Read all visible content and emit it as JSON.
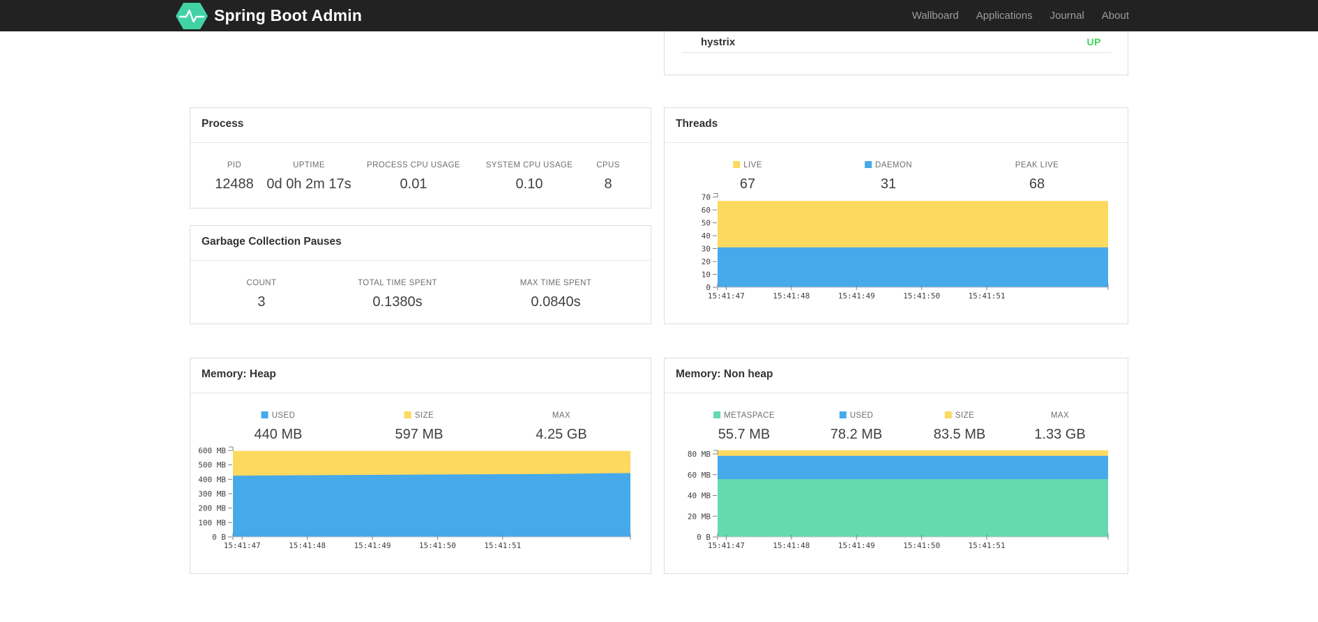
{
  "navbar": {
    "brand": "Spring Boot Admin",
    "links": [
      {
        "label": "Wallboard"
      },
      {
        "label": "Applications"
      },
      {
        "label": "Journal"
      },
      {
        "label": "About"
      }
    ]
  },
  "status_card": {
    "app_name": "hystrix",
    "status": "UP"
  },
  "cards": {
    "process": {
      "title": "Process",
      "stats": [
        {
          "label": "PID",
          "value": "12488"
        },
        {
          "label": "UPTIME",
          "value": "0d 0h 2m 17s"
        },
        {
          "label": "PROCESS CPU USAGE",
          "value": "0.01"
        },
        {
          "label": "SYSTEM CPU USAGE",
          "value": "0.10"
        },
        {
          "label": "CPUS",
          "value": "8"
        }
      ]
    },
    "gc": {
      "title": "Garbage Collection Pauses",
      "stats": [
        {
          "label": "COUNT",
          "value": "3"
        },
        {
          "label": "TOTAL TIME SPENT",
          "value": "0.1380s"
        },
        {
          "label": "MAX TIME SPENT",
          "value": "0.0840s"
        }
      ]
    },
    "threads": {
      "title": "Threads",
      "legend": [
        {
          "label": "LIVE",
          "value": "67",
          "swatch": "yellow"
        },
        {
          "label": "DAEMON",
          "value": "31",
          "swatch": "blue"
        },
        {
          "label": "PEAK LIVE",
          "value": "68",
          "swatch": null
        }
      ]
    },
    "heap": {
      "title": "Memory: Heap",
      "legend": [
        {
          "label": "USED",
          "value": "440 MB",
          "swatch": "blue"
        },
        {
          "label": "SIZE",
          "value": "597 MB",
          "swatch": "yellow"
        },
        {
          "label": "MAX",
          "value": "4.25 GB",
          "swatch": null
        }
      ]
    },
    "nonheap": {
      "title": "Memory: Non heap",
      "legend": [
        {
          "label": "METASPACE",
          "value": "55.7 MB",
          "swatch": "green"
        },
        {
          "label": "USED",
          "value": "78.2 MB",
          "swatch": "blue"
        },
        {
          "label": "SIZE",
          "value": "83.5 MB",
          "swatch": "yellow"
        },
        {
          "label": "MAX",
          "value": "1.33 GB",
          "swatch": null
        }
      ]
    }
  },
  "colors": {
    "yellow": "#FCD95F",
    "blue": "#46A9EA",
    "green": "#65D9AF",
    "status_up": "#3ED45A",
    "brand": "#42D3A5",
    "navbar_bg": "#222222"
  },
  "chart_data": [
    {
      "id": "threads",
      "type": "area",
      "stacked": true,
      "title": "Threads over time",
      "x_labels": [
        "15:41:47",
        "15:41:48",
        "15:41:49",
        "15:41:50",
        "15:41:51"
      ],
      "ylim": [
        0,
        70
      ],
      "y_ticks": [
        {
          "v": 0,
          "label": "0"
        },
        {
          "v": 10,
          "label": "10"
        },
        {
          "v": 20,
          "label": "20"
        },
        {
          "v": 30,
          "label": "30"
        },
        {
          "v": 40,
          "label": "40"
        },
        {
          "v": 50,
          "label": "50"
        },
        {
          "v": 60,
          "label": "60"
        },
        {
          "v": 70,
          "label": "70"
        }
      ],
      "series": [
        {
          "name": "DAEMON",
          "color_key": "blue",
          "stack_top_values": [
            31,
            31
          ]
        },
        {
          "name": "LIVE",
          "color_key": "yellow",
          "stack_top_values": [
            67,
            67
          ]
        }
      ]
    },
    {
      "id": "heap",
      "type": "area",
      "stacked": true,
      "title": "Heap memory over time (MB)",
      "x_labels": [
        "15:41:47",
        "15:41:48",
        "15:41:49",
        "15:41:50",
        "15:41:51"
      ],
      "ylim": [
        0,
        600
      ],
      "y_ticks": [
        {
          "v": 0,
          "label": "0 B"
        },
        {
          "v": 100,
          "label": "100 MB"
        },
        {
          "v": 200,
          "label": "200 MB"
        },
        {
          "v": 300,
          "label": "300 MB"
        },
        {
          "v": 400,
          "label": "400 MB"
        },
        {
          "v": 500,
          "label": "500 MB"
        },
        {
          "v": 600,
          "label": "600 MB"
        }
      ],
      "series": [
        {
          "name": "USED",
          "color_key": "blue",
          "stack_top_values": [
            425,
            428,
            431,
            434,
            437,
            443
          ]
        },
        {
          "name": "SIZE",
          "color_key": "yellow",
          "stack_top_values": [
            597,
            597
          ]
        }
      ]
    },
    {
      "id": "nonheap",
      "type": "area",
      "stacked": true,
      "title": "Non heap memory over time (MB)",
      "x_labels": [
        "15:41:47",
        "15:41:48",
        "15:41:49",
        "15:41:50",
        "15:41:51"
      ],
      "ylim": [
        0,
        80
      ],
      "y_ticks": [
        {
          "v": 0,
          "label": "0 B"
        },
        {
          "v": 20,
          "label": "20 MB"
        },
        {
          "v": 40,
          "label": "40 MB"
        },
        {
          "v": 60,
          "label": "60 MB"
        },
        {
          "v": 80,
          "label": "80 MB"
        }
      ],
      "series": [
        {
          "name": "METASPACE",
          "color_key": "green",
          "stack_top_values": [
            55.7,
            55.7
          ]
        },
        {
          "name": "USED",
          "color_key": "blue",
          "stack_top_values": [
            78.2,
            78.2
          ]
        },
        {
          "name": "SIZE",
          "color_key": "yellow",
          "stack_top_values": [
            83.5,
            83.5
          ]
        }
      ]
    }
  ]
}
